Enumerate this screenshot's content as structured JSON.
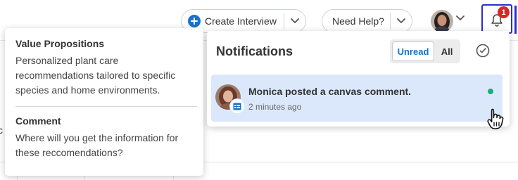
{
  "topbar": {
    "create_interview_label": "Create Interview",
    "need_help_label": "Need Help?",
    "notification_count": "1"
  },
  "background": {
    "partial_letter": "c"
  },
  "comment_popover": {
    "value_propositions_heading": "Value Propositions",
    "value_propositions_text": "Personalized plant care recommendations tailored to specific species and home environments.",
    "comment_heading": "Comment",
    "comment_text": "Where will you get the information for these reccomendations?"
  },
  "notifications": {
    "title": "Notifications",
    "filter_unread": "Unread",
    "filter_all": "All",
    "items": [
      {
        "message": "Monica posted a canvas comment.",
        "time": "2 minutes ago",
        "unread": true
      }
    ]
  },
  "colors": {
    "accent_blue": "#1a73c9",
    "selection_border": "#2b2fc8",
    "badge_red": "#d62828",
    "unread_green": "#18b07a",
    "item_highlight": "#dbe8fb"
  },
  "icons": [
    "plus-icon",
    "chevron-down-icon",
    "bell-icon",
    "check-circle-icon",
    "canvas-icon",
    "hand-cursor-icon"
  ]
}
